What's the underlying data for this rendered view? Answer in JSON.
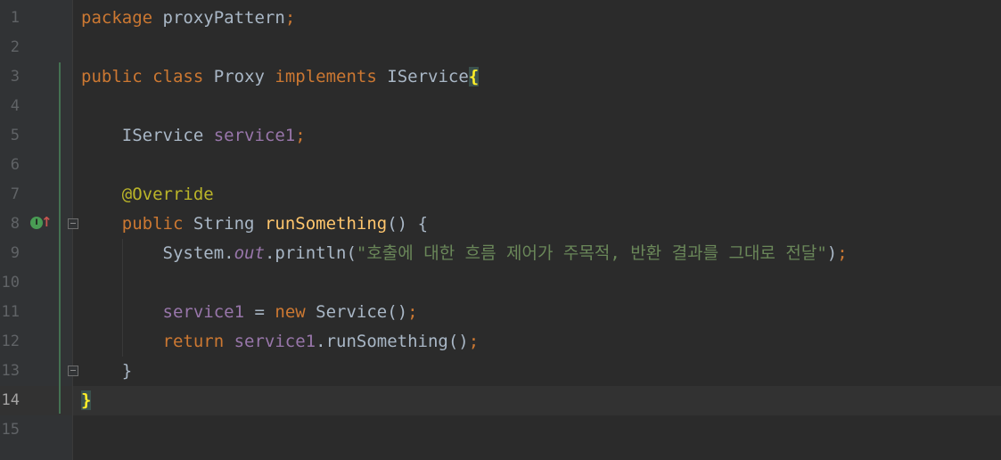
{
  "editor": {
    "current_line": "14",
    "gutter_icons": {
      "implements_marker": "I",
      "overrides_marker": "↑"
    },
    "lines": [
      {
        "number": "1",
        "tokens": [
          "package",
          "proxyPattern",
          ";"
        ]
      },
      {
        "number": "2"
      },
      {
        "number": "3",
        "tokens": [
          "public",
          "class",
          "Proxy",
          "implements",
          "IService",
          "{"
        ]
      },
      {
        "number": "4"
      },
      {
        "number": "5",
        "tokens": [
          "IService",
          "service1",
          ";"
        ]
      },
      {
        "number": "6"
      },
      {
        "number": "7",
        "tokens": [
          "@Override"
        ]
      },
      {
        "number": "8",
        "tokens": [
          "public",
          "String",
          "runSomething",
          "()",
          "{"
        ]
      },
      {
        "number": "9",
        "tokens": [
          "System",
          ".",
          "out",
          ".println(",
          "\"호출에 대한 흐름 제어가 주목적, 반환 결과를 그대로 전달\"",
          ")",
          ";"
        ]
      },
      {
        "number": "10"
      },
      {
        "number": "11",
        "tokens": [
          "service1",
          "=",
          "new",
          "Service",
          "()",
          ";"
        ]
      },
      {
        "number": "12",
        "tokens": [
          "return",
          "service1",
          ".runSomething()",
          ";"
        ]
      },
      {
        "number": "13",
        "tokens": [
          "}"
        ]
      },
      {
        "number": "14",
        "tokens": [
          "}"
        ]
      },
      {
        "number": "15"
      }
    ]
  },
  "colors": {
    "background": "#2b2b2b",
    "gutter": "#313335",
    "keyword": "#cc7832",
    "identifier": "#a9b7c6",
    "field": "#9876aa",
    "annotation": "#bbb529",
    "method_declaration": "#ffc66d",
    "string": "#6a8759",
    "line_number": "#606366",
    "brace_match": "#ffef28",
    "vcs_added": "#447152"
  }
}
